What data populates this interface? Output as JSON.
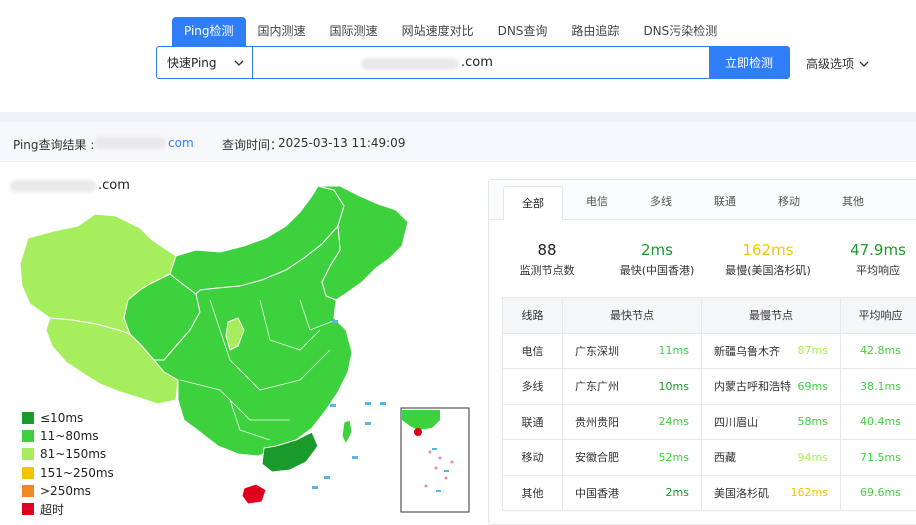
{
  "tabs": [
    "Ping检测",
    "国内测速",
    "国际测速",
    "网站速度对比",
    "DNS查询",
    "路由追踪",
    "DNS污染检测"
  ],
  "search": {
    "mode": "快速Ping",
    "domain_suffix": ".com",
    "check_button": "立即检测",
    "advanced": "高级选项"
  },
  "result": {
    "label": "Ping查询结果 :",
    "domain_suffix": "com",
    "time_label": "查询时间：",
    "time": "2025-03-13 11:49:09"
  },
  "map": {
    "domain_suffix": ".com",
    "legend": [
      {
        "label": "≤10ms",
        "color": "#1a9a2a"
      },
      {
        "label": "11~80ms",
        "color": "#3ed13e"
      },
      {
        "label": "81~150ms",
        "color": "#a7ee5e"
      },
      {
        "label": "151~250ms",
        "color": "#f5c400"
      },
      {
        "label": ">250ms",
        "color": "#f08a24"
      },
      {
        "label": "超时",
        "color": "#e0001b"
      }
    ]
  },
  "panel": {
    "tabs": [
      "全部",
      "电信",
      "多线",
      "联通",
      "移动",
      "其他"
    ],
    "stats": [
      {
        "value": "88",
        "label": "监测节点数",
        "color": "#222222"
      },
      {
        "value": "2ms",
        "label": "最快(中国香港)",
        "color": "#1a9a2a"
      },
      {
        "value": "162ms",
        "label": "最慢(美国洛杉矶)",
        "color": "#f5c400"
      },
      {
        "value": "47.9ms",
        "label": "平均响应",
        "color": "#1a9a2a"
      }
    ],
    "table": {
      "headers": [
        "线路",
        "最快节点",
        "最慢节点",
        "平均响应"
      ],
      "rows": [
        {
          "line": "电信",
          "fast": "广东深圳",
          "fast_ms": "11ms",
          "slow": "新疆乌鲁木齐",
          "slow_ms": "87ms",
          "avg": "42.8ms"
        },
        {
          "line": "多线",
          "fast": "广东广州",
          "fast_ms": "10ms",
          "slow": "内蒙古呼和浩特",
          "slow_ms": "69ms",
          "avg": "38.1ms"
        },
        {
          "line": "联通",
          "fast": "贵州贵阳",
          "fast_ms": "24ms",
          "slow": "四川眉山",
          "slow_ms": "58ms",
          "avg": "40.4ms"
        },
        {
          "line": "移动",
          "fast": "安徽合肥",
          "fast_ms": "52ms",
          "slow": "西藏",
          "slow_ms": "94ms",
          "avg": "71.5ms"
        },
        {
          "line": "其他",
          "fast": "中国香港",
          "fast_ms": "2ms",
          "slow": "美国洛杉矶",
          "slow_ms": "162ms",
          "avg": "69.6ms"
        }
      ]
    }
  }
}
